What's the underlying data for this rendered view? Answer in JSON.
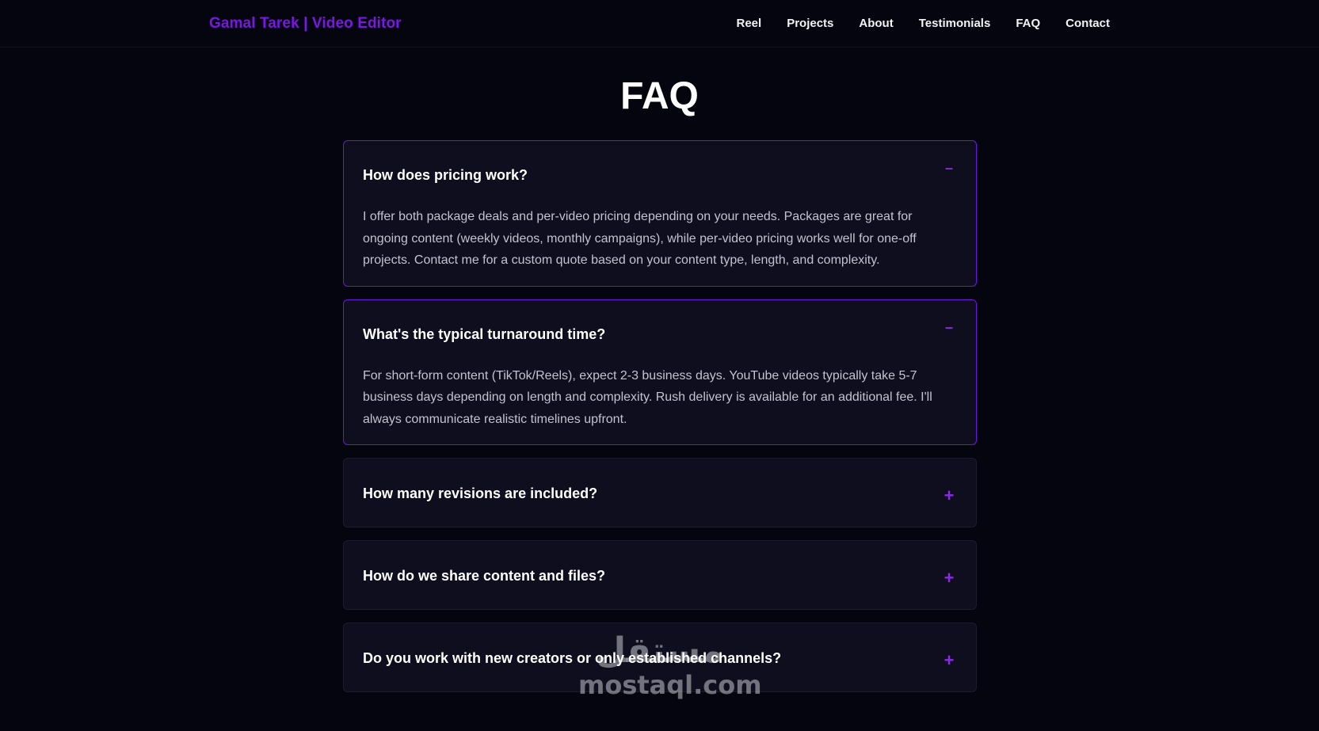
{
  "header": {
    "brand": "Gamal Tarek | Video Editor",
    "nav": [
      "Reel",
      "Projects",
      "About",
      "Testimonials",
      "FAQ",
      "Contact"
    ]
  },
  "main": {
    "title": "FAQ",
    "faq": [
      {
        "question": "How does pricing work?",
        "answer": "I offer both package deals and per-video pricing depending on your needs. Packages are great for ongoing content (weekly videos, monthly campaigns), while per-video pricing works well for one-off projects. Contact me for a custom quote based on your content type, length, and complexity.",
        "expanded": true,
        "toggle": "–"
      },
      {
        "question": "What's the typical turnaround time?",
        "answer": "For short-form content (TikTok/Reels), expect 2-3 business days. YouTube videos typically take 5-7 business days depending on length and complexity. Rush delivery is available for an additional fee. I'll always communicate realistic timelines upfront.",
        "expanded": true,
        "toggle": "–"
      },
      {
        "question": "How many revisions are included?",
        "expanded": false,
        "toggle": "+"
      },
      {
        "question": "How do we share content and files?",
        "expanded": false,
        "toggle": "+"
      },
      {
        "question": "Do you work with new creators or only established channels?",
        "expanded": false,
        "toggle": "+"
      }
    ]
  },
  "watermark": {
    "arabic": "مستقل",
    "latin": "mostaql.com"
  },
  "colors": {
    "background": "#05050f",
    "accent": "#7b16e6",
    "card": "#0e0e1f",
    "open_border": "#6d17dc"
  }
}
